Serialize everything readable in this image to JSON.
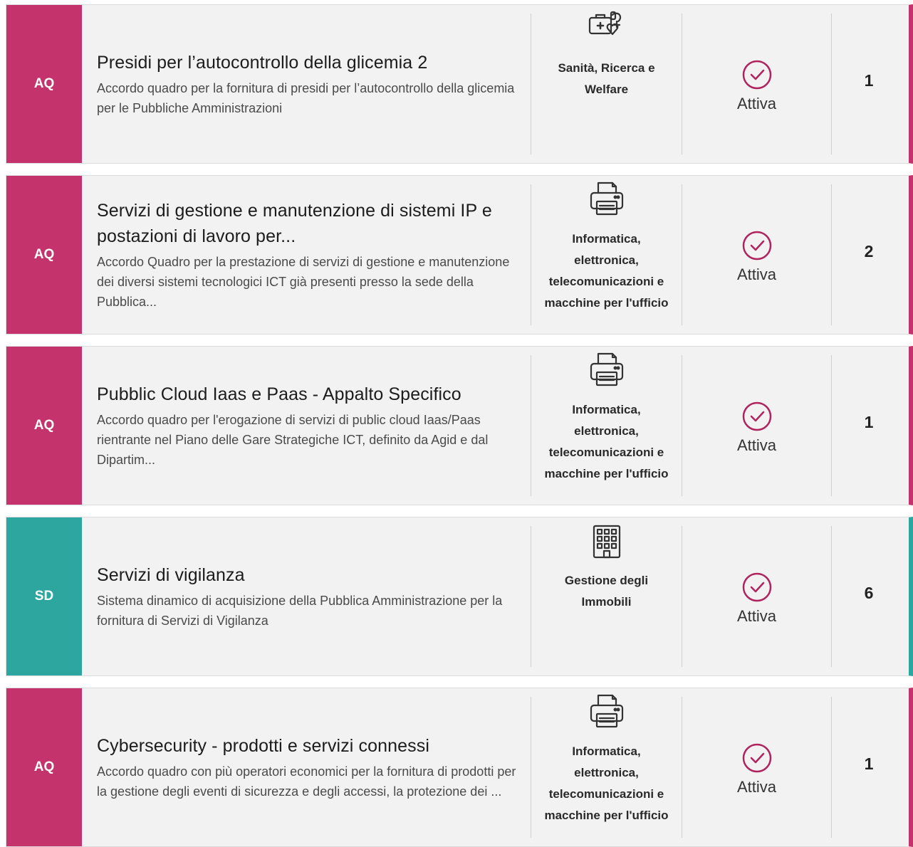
{
  "colors": {
    "aq": "#c4336b",
    "sd": "#2da6a0"
  },
  "status_icon": "check-circle-icon",
  "cards": [
    {
      "badge": "AQ",
      "color": "#c4336b",
      "title": "Presidi per l’autocontrollo della glicemia 2",
      "description": "Accordo quadro per la fornitura di presidi per l’autocontrollo della glicemia per le Pubbliche Amministrazioni",
      "category_icon": "medical-kit-icon",
      "category": "Sanità, Ricerca e Welfare",
      "status": "Attiva",
      "count": "1"
    },
    {
      "badge": "AQ",
      "color": "#c4336b",
      "title": "Servizi di gestione e manutenzione di sistemi IP e postazioni di lavoro per...",
      "description": "Accordo Quadro per la prestazione di servizi di gestione e manutenzione dei diversi sistemi tecnologici ICT già presenti presso la sede della Pubblica...",
      "category_icon": "printer-icon",
      "category": "Informatica, elettronica, telecomunicazioni e macchine per l'ufficio",
      "status": "Attiva",
      "count": "2"
    },
    {
      "badge": "AQ",
      "color": "#c4336b",
      "title": "Pubblic Cloud Iaas e Paas - Appalto Specifico",
      "description": "Accordo quadro per l'erogazione di servizi di public cloud Iaas/Paas rientrante nel Piano delle Gare Strategiche ICT, definito da Agid e dal Dipartim...",
      "category_icon": "printer-icon",
      "category": "Informatica, elettronica, telecomunicazioni e macchine per l'ufficio",
      "status": "Attiva",
      "count": "1"
    },
    {
      "badge": "SD",
      "color": "#2da6a0",
      "title": "Servizi di vigilanza",
      "description": "Sistema dinamico di acquisizione della Pubblica Amministrazione per la fornitura di Servizi di Vigilanza",
      "category_icon": "building-icon",
      "category": "Gestione degli Immobili",
      "status": "Attiva",
      "count": "6"
    },
    {
      "badge": "AQ",
      "color": "#c4336b",
      "title": "Cybersecurity - prodotti e servizi connessi",
      "description": "Accordo quadro con più operatori economici per la fornitura di prodotti per la gestione degli eventi di sicurezza e degli accessi, la protezione dei ...",
      "category_icon": "printer-icon",
      "category": "Informatica, elettronica, telecomunicazioni e macchine per l'ufficio",
      "status": "Attiva",
      "count": "1"
    }
  ]
}
